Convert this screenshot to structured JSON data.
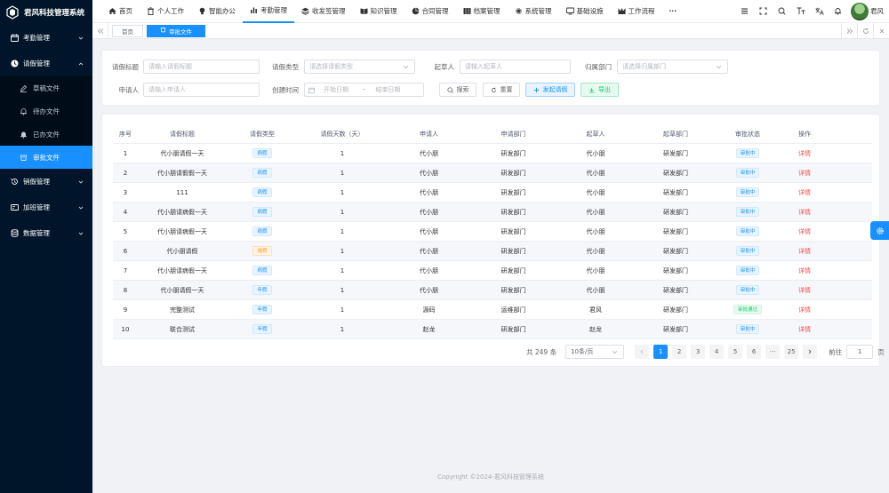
{
  "app": {
    "title": "君风科技管理系统"
  },
  "sidebar": {
    "items": [
      {
        "label": "考勤管理",
        "icon": "calendar-icon",
        "expanded": false
      },
      {
        "label": "请假管理",
        "icon": "clock-icon",
        "expanded": true,
        "children": [
          {
            "label": "草稿文件",
            "icon": "edit-icon"
          },
          {
            "label": "待办文件",
            "icon": "bell-outline-icon"
          },
          {
            "label": "已办文件",
            "icon": "bell-filled-icon"
          },
          {
            "label": "审批文件",
            "icon": "cup-icon",
            "active": true
          }
        ]
      },
      {
        "label": "销假管理",
        "icon": "history-icon",
        "expanded": false
      },
      {
        "label": "加班管理",
        "icon": "id-card-icon",
        "expanded": false
      },
      {
        "label": "数据管理",
        "icon": "database-icon",
        "expanded": false
      }
    ]
  },
  "topnav": {
    "items": [
      {
        "label": "首页",
        "icon": "home-icon"
      },
      {
        "label": "个人工作",
        "icon": "trash-icon"
      },
      {
        "label": "智能办公",
        "icon": "lightbulb-icon"
      },
      {
        "label": "考勤管理",
        "icon": "bar-chart-icon",
        "active": true
      },
      {
        "label": "收发签管理",
        "icon": "layers-icon"
      },
      {
        "label": "知识管理",
        "icon": "book-icon"
      },
      {
        "label": "合同管理",
        "icon": "pie-chart-icon"
      },
      {
        "label": "档案管理",
        "icon": "archive-icon"
      },
      {
        "label": "系统管理",
        "icon": "gear-icon"
      },
      {
        "label": "基础设施",
        "icon": "monitor-icon"
      },
      {
        "label": "工作流程",
        "icon": "workflow-icon"
      }
    ],
    "more": "···",
    "user_name": "君风"
  },
  "tags": {
    "items": [
      {
        "label": "首页",
        "active": false
      },
      {
        "label": "审批文件",
        "active": true
      }
    ]
  },
  "search": {
    "title_label": "请假标题",
    "title_placeholder": "请输入请假标题",
    "type_label": "请假类型",
    "type_placeholder": "请选择请假类型",
    "drafter_label": "起草人",
    "drafter_placeholder": "请输入起草人",
    "dept_label": "归属部门",
    "dept_placeholder": "请选择归属部门",
    "applicant_label": "申请人",
    "applicant_placeholder": "请输入申请人",
    "created_label": "创建时间",
    "start_placeholder": "开始日期",
    "range_sep": "-",
    "end_placeholder": "结束日期",
    "search_btn": "搜索",
    "reset_btn": "重置",
    "apply_btn": "发起请假",
    "export_btn": "导出"
  },
  "table": {
    "columns": [
      "序号",
      "请假标题",
      "请假类型",
      "请假天数（天）",
      "申请人",
      "申请部门",
      "起草人",
      "起草部门",
      "审批状态",
      "操作"
    ],
    "rows": [
      {
        "no": "1",
        "title": "代小朋请假一天",
        "type": "病假",
        "type_color": "blue",
        "days": "1",
        "applicant": "代小朋",
        "dept": "研发部门",
        "drafter": "代小朋",
        "drafter_dept": "研发部门",
        "status": "审批中",
        "status_color": "blue",
        "action": "详情"
      },
      {
        "no": "2",
        "title": "代小朋请假假一天",
        "type": "病假",
        "type_color": "blue",
        "days": "1",
        "applicant": "代小朋",
        "dept": "研发部门",
        "drafter": "代小朋",
        "drafter_dept": "研发部门",
        "status": "审批中",
        "status_color": "blue",
        "action": "详情"
      },
      {
        "no": "3",
        "title": "111",
        "type": "病假",
        "type_color": "blue",
        "days": "1",
        "applicant": "代小朋",
        "dept": "研发部门",
        "drafter": "代小朋",
        "drafter_dept": "研发部门",
        "status": "审批中",
        "status_color": "blue",
        "action": "详情"
      },
      {
        "no": "4",
        "title": "代小朋请病假一天",
        "type": "病假",
        "type_color": "blue",
        "days": "1",
        "applicant": "代小朋",
        "dept": "研发部门",
        "drafter": "代小朋",
        "drafter_dept": "研发部门",
        "status": "审批中",
        "status_color": "blue",
        "action": "详情"
      },
      {
        "no": "5",
        "title": "代小朋请病假一天",
        "type": "病假",
        "type_color": "blue",
        "days": "1",
        "applicant": "代小朋",
        "dept": "研发部门",
        "drafter": "代小朋",
        "drafter_dept": "研发部门",
        "status": "审批中",
        "status_color": "blue",
        "action": "详情"
      },
      {
        "no": "6",
        "title": "代小朋请假",
        "type": "婚假",
        "type_color": "orange",
        "days": "1",
        "applicant": "代小朋",
        "dept": "研发部门",
        "drafter": "代小朋",
        "drafter_dept": "研发部门",
        "status": "审批中",
        "status_color": "blue",
        "action": "详情"
      },
      {
        "no": "7",
        "title": "代小朋请病假一天",
        "type": "病假",
        "type_color": "blue",
        "days": "1",
        "applicant": "代小朋",
        "dept": "研发部门",
        "drafter": "代小朋",
        "drafter_dept": "研发部门",
        "status": "审批中",
        "status_color": "blue",
        "action": "详情"
      },
      {
        "no": "8",
        "title": "代小朋请假一天",
        "type": "年假",
        "type_color": "blue",
        "days": "1",
        "applicant": "代小朋",
        "dept": "研发部门",
        "drafter": "代小朋",
        "drafter_dept": "研发部门",
        "status": "审批中",
        "status_color": "blue",
        "action": "详情"
      },
      {
        "no": "9",
        "title": "完整测试",
        "type": "年假",
        "type_color": "blue",
        "days": "1",
        "applicant": "源码",
        "dept": "运维部门",
        "drafter": "君风",
        "drafter_dept": "研发部门",
        "status": "审批通过",
        "status_color": "green",
        "action": "详情"
      },
      {
        "no": "10",
        "title": "联合测试",
        "type": "年假",
        "type_color": "blue",
        "days": "1",
        "applicant": "赵龙",
        "dept": "研发部门",
        "drafter": "赵龙",
        "drafter_dept": "研发部门",
        "status": "审批中",
        "status_color": "blue",
        "action": "详情"
      }
    ]
  },
  "pagination": {
    "total_text": "共 249 条",
    "page_size": "10条/页",
    "pages": [
      "1",
      "2",
      "3",
      "4",
      "5",
      "6",
      "···",
      "25"
    ],
    "current": "1",
    "goto_label": "前往",
    "goto_value": "1",
    "goto_unit": "页"
  },
  "footer": {
    "text": "Copyright ©2024-君风科技管理系统"
  },
  "colors": {
    "primary": "#1890ff",
    "sidebar_bg": "#001529",
    "danger": "#ff4949",
    "success": "#13ce66",
    "warning": "#ff9a2e"
  }
}
